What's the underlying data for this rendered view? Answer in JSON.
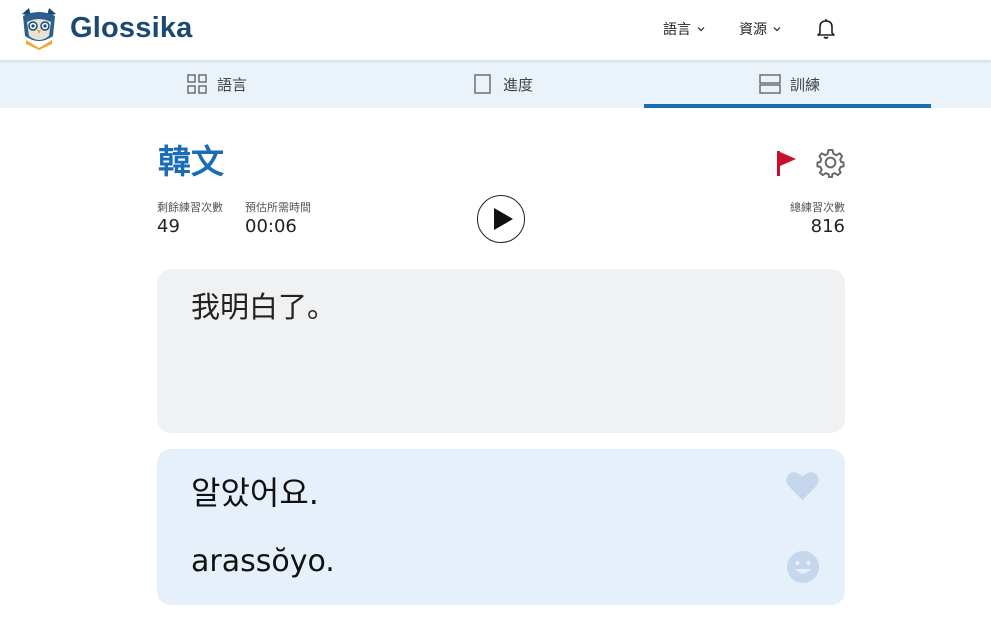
{
  "app": {
    "brand": "Glossika"
  },
  "header": {
    "nav": [
      {
        "label": "語言",
        "icon": "chevron-down-icon"
      },
      {
        "label": "資源",
        "icon": "chevron-down-icon"
      }
    ],
    "notification_icon": "bell-icon"
  },
  "tabs": [
    {
      "label": "語言",
      "icon": "grid-icon",
      "active": false
    },
    {
      "label": "進度",
      "icon": "square-icon",
      "active": false
    },
    {
      "label": "訓練",
      "icon": "rows-icon",
      "active": true
    }
  ],
  "session": {
    "language": "韓文",
    "remaining_label": "剩餘練習次數",
    "remaining_value": "49",
    "estimated_label": "預估所需時間",
    "estimated_value": "00:06",
    "total_label": "總練習次數",
    "total_value": "816"
  },
  "sentence": {
    "source": "我明白了。",
    "target": "알았어요.",
    "romanization": "arassŏyo."
  },
  "colors": {
    "accent": "#1a6db4",
    "brand": "#1a4a72",
    "flag": "#c8102e",
    "tab_bar": "#eaf2fa",
    "source_card": "#f0f1f3",
    "target_card": "#e5f0fa",
    "icon_muted": "#c4d7ec"
  }
}
